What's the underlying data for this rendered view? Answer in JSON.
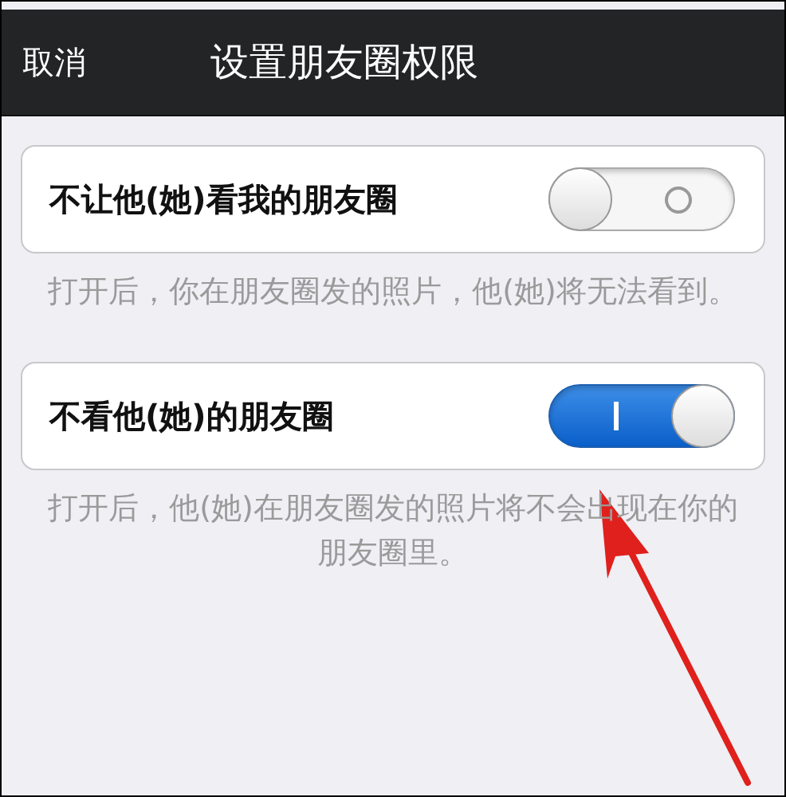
{
  "nav_bar": {
    "cancel": "取消",
    "title": "设置朋友圈权限"
  },
  "settings": [
    {
      "label": "不让他(她)看我的朋友圈",
      "on": false,
      "description": "打开后，你在朋友圈发的照片，他(她)将无法看到。"
    },
    {
      "label": "不看他(她)的朋友圈",
      "on": true,
      "description": "打开后，他(她)在朋友圈发的照片将不会出现在你的朋友圈里。"
    }
  ]
}
